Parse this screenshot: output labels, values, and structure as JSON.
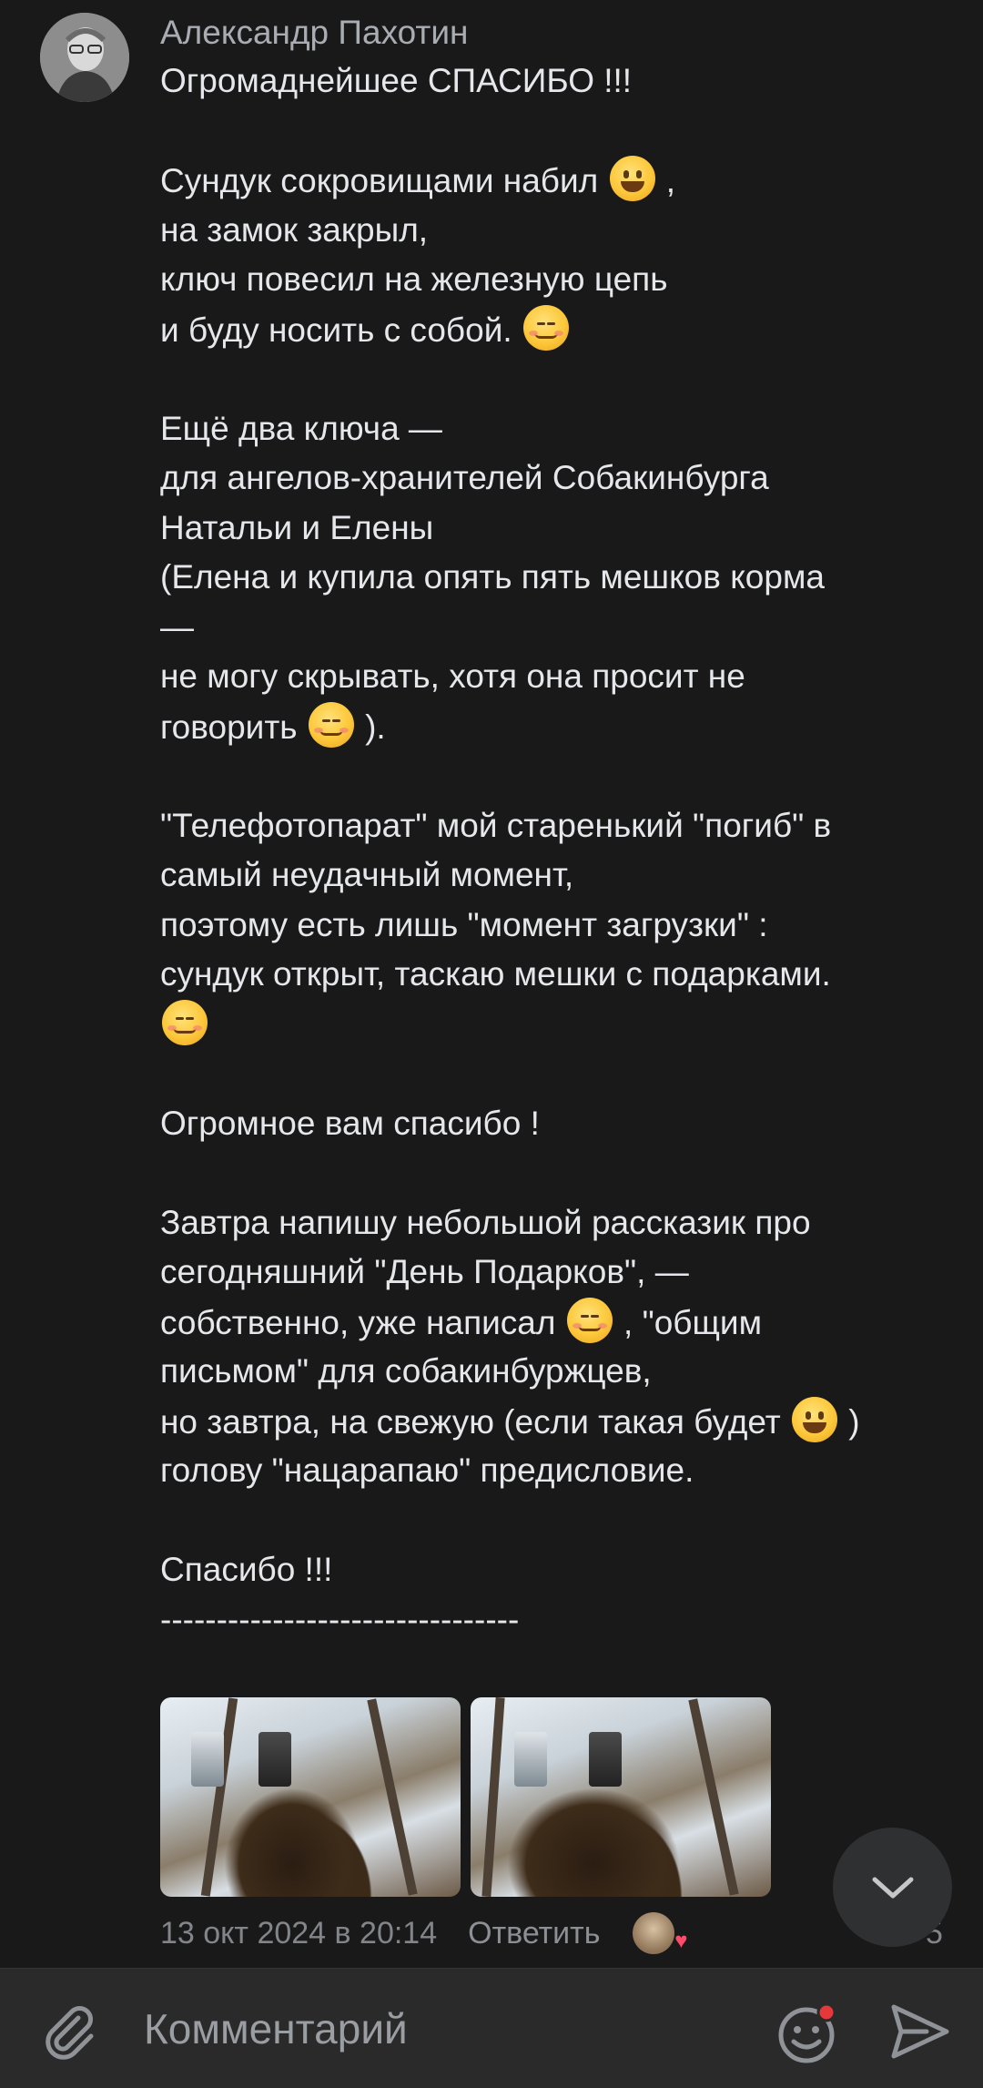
{
  "comment": {
    "author": "Александр Пахотин",
    "lines": [
      "Огромаднейшее СПАСИБО !!!",
      "",
      "Сундук сокровищами набил [grin] ,",
      "на замок закрыл,",
      "ключ повесил на железную цепь",
      "и буду носить с собой. [blush]",
      "",
      "Ещё два ключа —",
      "для ангелов-хранителей Собакинбурга",
      "Натальи и Елены",
      "(Елена и купила опять пять мешков корма",
      "—",
      "не могу скрывать, хотя она просит не",
      "говорить [blush] ).",
      "",
      "\"Телефотопарат\" мой старенький \"погиб\" в",
      "самый неудачный момент,",
      "поэтому есть лишь \"момент загрузки\" :",
      "сундук открыт, таскаю мешки с подарками.",
      "[blush]",
      "",
      "Огромное вам спасибо !",
      "",
      "Завтра напишу небольшой рассказик про",
      "сегодняшний \"День Подарков\", —",
      "собственно, уже написал [blush] , \"общим",
      "письмом\" для собакинбуржцев,",
      "но завтра, на свежую (если такая будет [grin] )",
      "голову \"нацарапаю\" предисловие.",
      "",
      "Спасибо !!!",
      "--------------------------------"
    ],
    "photos": [
      {
        "alt": "dog-in-snowy-forest-photo-1"
      },
      {
        "alt": "dog-in-snowy-forest-photo-2"
      }
    ],
    "timestamp": "13 окт 2024 в 20:14",
    "reply_label": "Ответить",
    "reactions_count": "5"
  },
  "composer": {
    "placeholder": "Комментарий"
  },
  "colors": {
    "background": "#19191a",
    "bar": "#2a2a2b",
    "text": "#e6e7ea",
    "muted": "#828589",
    "badge": "#e5383b"
  }
}
